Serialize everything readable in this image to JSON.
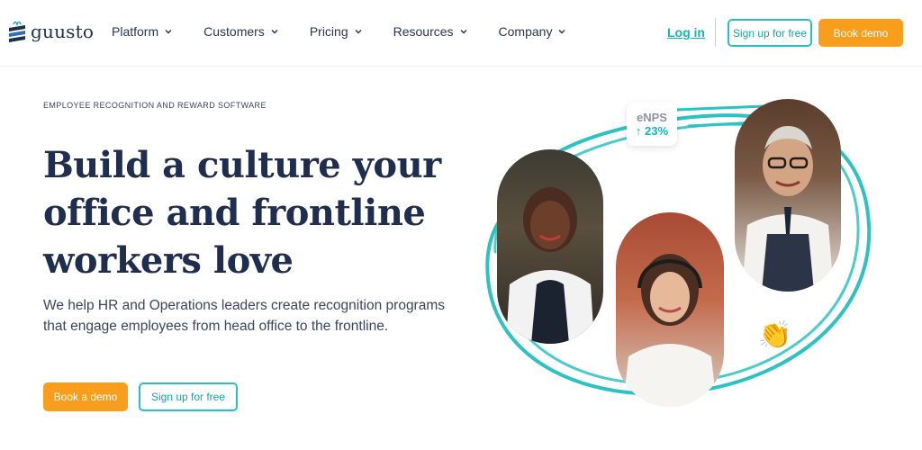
{
  "brand": {
    "name": "guusto"
  },
  "nav": {
    "items": [
      {
        "label": "Platform"
      },
      {
        "label": "Customers"
      },
      {
        "label": "Pricing"
      },
      {
        "label": "Resources"
      },
      {
        "label": "Company"
      }
    ],
    "login_label": "Log in",
    "signup_label": "Sign up for free",
    "demo_label": "Book demo"
  },
  "hero": {
    "eyebrow": "EMPLOYEE RECOGNITION AND REWARD SOFTWARE",
    "headline": "Build a culture your office and frontline workers love",
    "subheadline": "We help HR and Operations leaders create recognition programs that engage employees from head office to the frontline.",
    "demo_label": "Book a demo",
    "signup_label": "Sign up for free"
  },
  "stat": {
    "label": "eNPS",
    "value": "↑ 23%"
  },
  "decor": {
    "clap_emoji": "👏"
  },
  "colors": {
    "accent": "#14b5b8",
    "cta": "#f99d1c",
    "navy": "#1f2d4e"
  }
}
